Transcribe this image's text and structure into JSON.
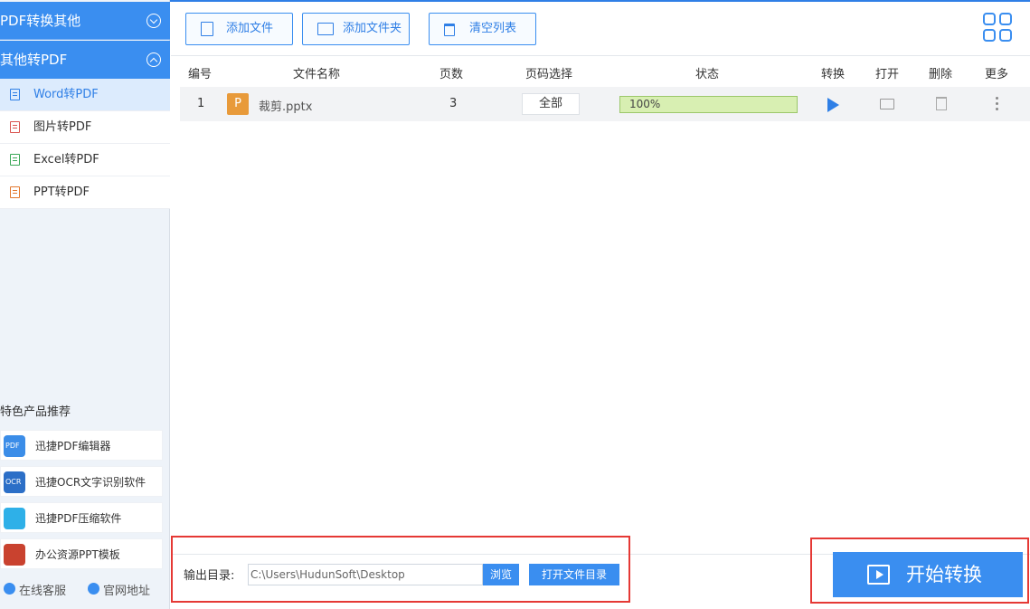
{
  "sidebar": {
    "categories": [
      {
        "label": "PDF转换其他"
      },
      {
        "label": "其他转PDF"
      }
    ],
    "items": [
      {
        "label": "Word转PDF"
      },
      {
        "label": "图片转PDF"
      },
      {
        "label": "Excel转PDF"
      },
      {
        "label": "PPT转PDF"
      }
    ],
    "rec_title": "特色产品推荐",
    "recommendations": [
      {
        "label": "迅捷PDF编辑器"
      },
      {
        "label": "迅捷OCR文字识别软件"
      },
      {
        "label": "迅捷PDF压缩软件"
      },
      {
        "label": "办公资源PPT模板"
      }
    ],
    "footer": {
      "service": "在线客服",
      "website": "官网地址"
    }
  },
  "toolbar": {
    "add_file": "添加文件",
    "add_folder": "添加文件夹",
    "clear_list": "清空列表"
  },
  "table": {
    "headers": [
      "编号",
      "文件名称",
      "页数",
      "页码选择",
      "状态",
      "转换",
      "打开",
      "删除",
      "更多"
    ],
    "rows": [
      {
        "num": "1",
        "badge": "P",
        "name": "裁剪.pptx",
        "pages": "3",
        "page_select": "全部",
        "status": "100%",
        "progress": 1.0
      }
    ]
  },
  "bottom": {
    "output_label": "输出目录:",
    "output_path": "C:\\Users\\HudunSoft\\Desktop",
    "browse": "浏览",
    "open_dir": "打开文件目录",
    "start": "开始转换"
  },
  "colors": {
    "accent": "#3a8ef0",
    "highlight_box": "#e53935",
    "progress_fill": "#d8efb2"
  }
}
